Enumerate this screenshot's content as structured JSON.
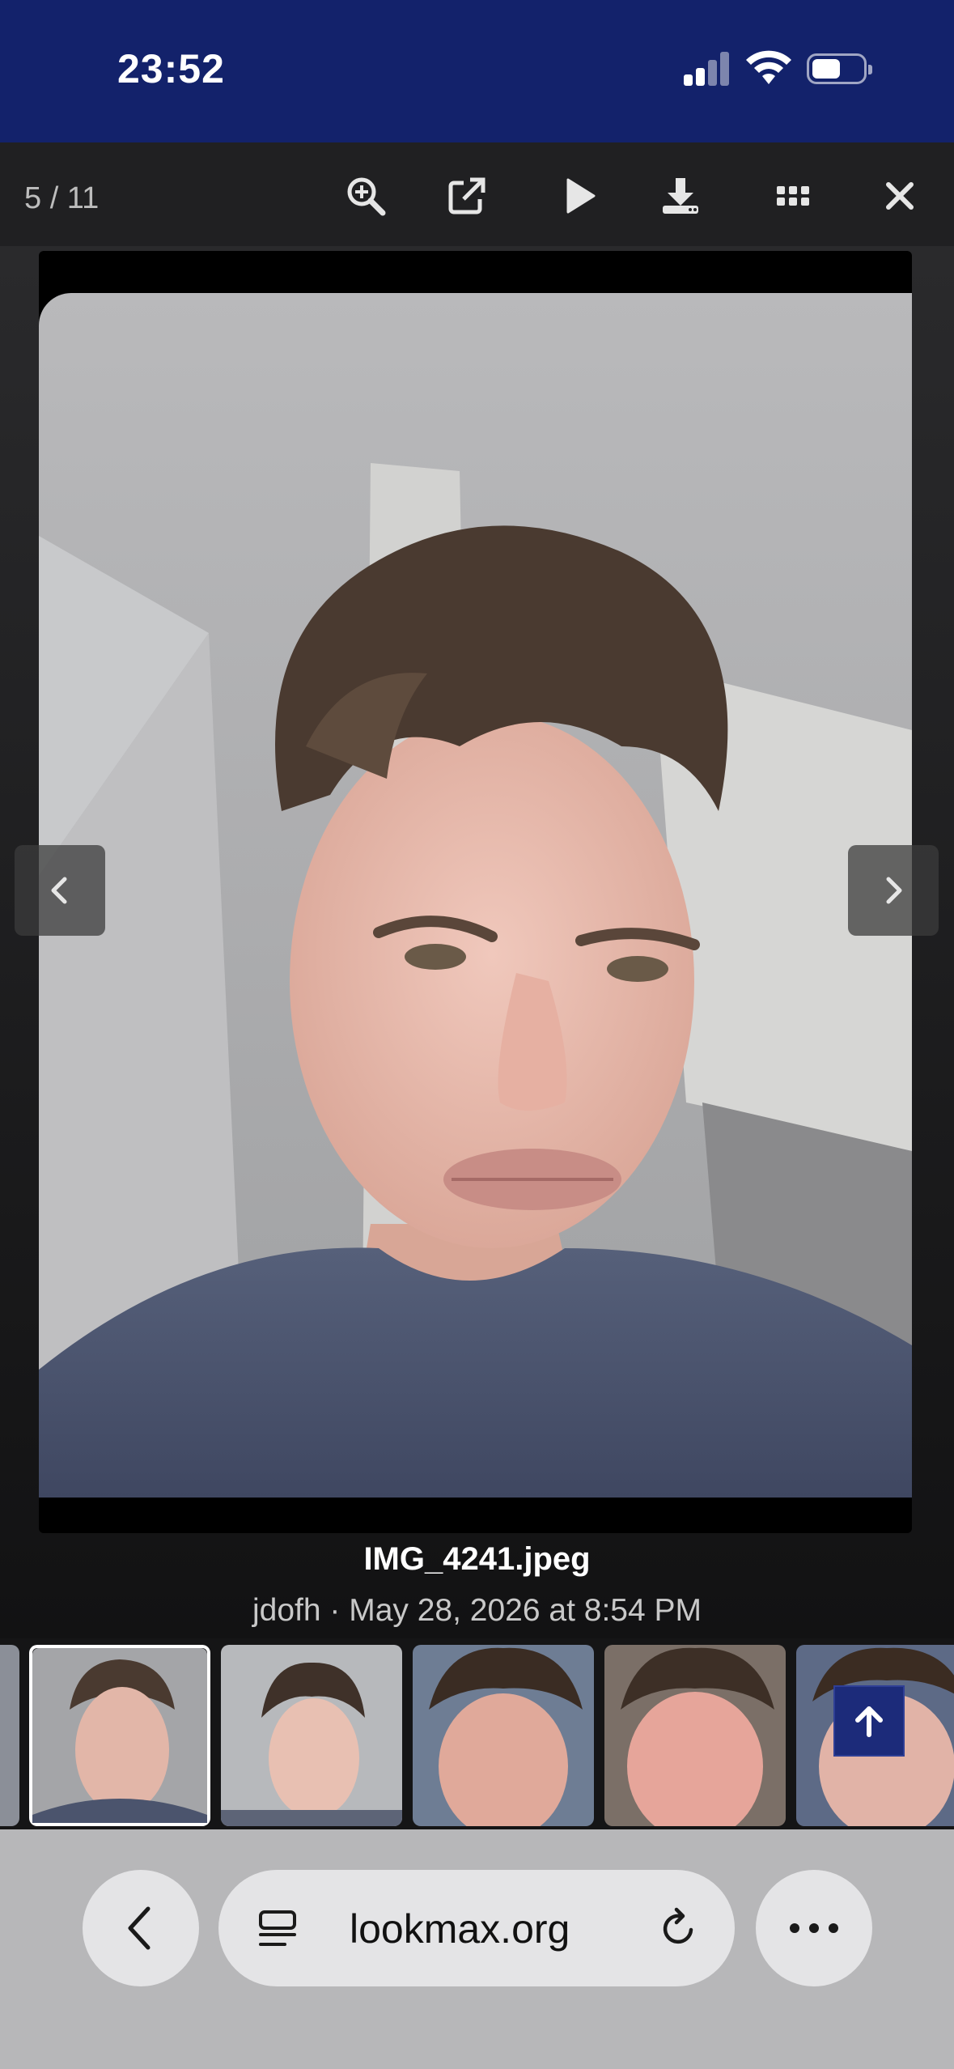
{
  "status_bar": {
    "time": "23:52"
  },
  "lightbox": {
    "counter": "5 / 11",
    "toolbar_icons": [
      "zoom-in-icon",
      "open-external-icon",
      "play-icon",
      "download-icon",
      "grid-icon",
      "close-icon"
    ],
    "filename": "IMG_4241.jpeg",
    "meta": "jdofh · May 28, 2026 at 8:54 PM"
  },
  "thumbnails": {
    "count_visible": 6,
    "active_index": 1
  },
  "browser": {
    "url": "lookmax.org"
  },
  "colors": {
    "status_bg": "#13226b",
    "toolbar_bg": "#202022",
    "browser_bg": "#b7b7b9",
    "to_top_bg": "#1c2b7a"
  }
}
